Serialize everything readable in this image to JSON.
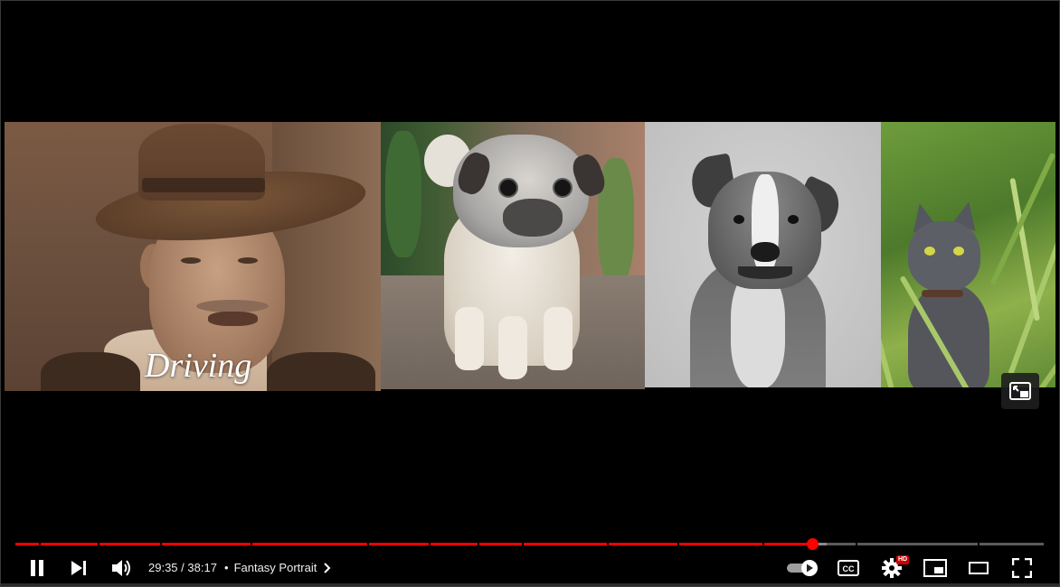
{
  "player": {
    "caption": "Driving",
    "time_current": "29:35",
    "time_separator": "/",
    "time_total": "38:17",
    "chapter_separator": "•",
    "chapter_title": "Fantasy Portrait",
    "hd_badge": "HD",
    "progress_fraction": 0.775,
    "accent_color": "#ff0000"
  },
  "icons": {
    "pause": "pause-icon",
    "next": "next-icon",
    "volume": "volume-icon",
    "chapter_chevron": "chevron-right-icon",
    "autoplay": "autoplay-toggle-icon",
    "captions": "cc-icon",
    "settings": "gear-icon",
    "miniplayer": "miniplayer-icon",
    "theater": "theater-icon",
    "fullscreen": "fullscreen-icon"
  }
}
